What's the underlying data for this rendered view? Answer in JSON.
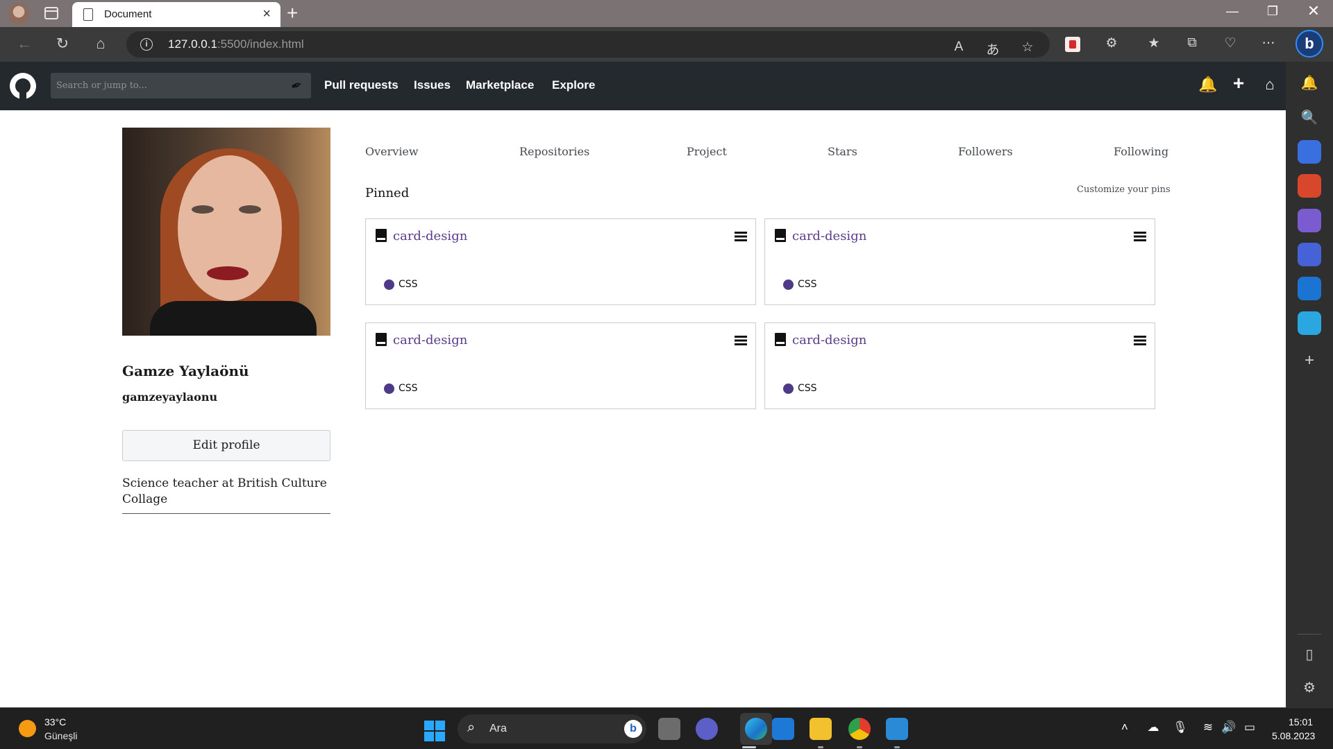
{
  "browser": {
    "tab_title": "Document",
    "url_host": "127.0.0.1",
    "url_rest": ":5500/index.html",
    "bing_label": "b"
  },
  "github": {
    "search_placeholder": "Search or jump to...",
    "nav": [
      "Pull requests",
      "Issues",
      "Marketplace",
      "Explore"
    ]
  },
  "profile": {
    "name": "Gamze Yaylaönü",
    "username": "gamzeyaylaonu",
    "edit_label": "Edit profile",
    "bio": "Science teacher at British Culture Collage"
  },
  "tabs": [
    "Overview",
    "Repositories",
    "Project",
    "Stars",
    "Followers",
    "Following"
  ],
  "pinned": {
    "title": "Pinned",
    "customize_label": "Customize your pins",
    "cards": [
      {
        "name": "card-design",
        "language": "CSS"
      },
      {
        "name": "card-design",
        "language": "CSS"
      },
      {
        "name": "card-design",
        "language": "CSS"
      },
      {
        "name": "card-design",
        "language": "CSS"
      }
    ]
  },
  "colors": {
    "github_header": "#24292e",
    "repo_link": "#5b3a8a",
    "css_language": "#4e3a86"
  },
  "taskbar": {
    "temperature": "33°C",
    "weather": "Güneşli",
    "search_label": "Ara",
    "time": "15:01",
    "date": "5.08.2023"
  }
}
